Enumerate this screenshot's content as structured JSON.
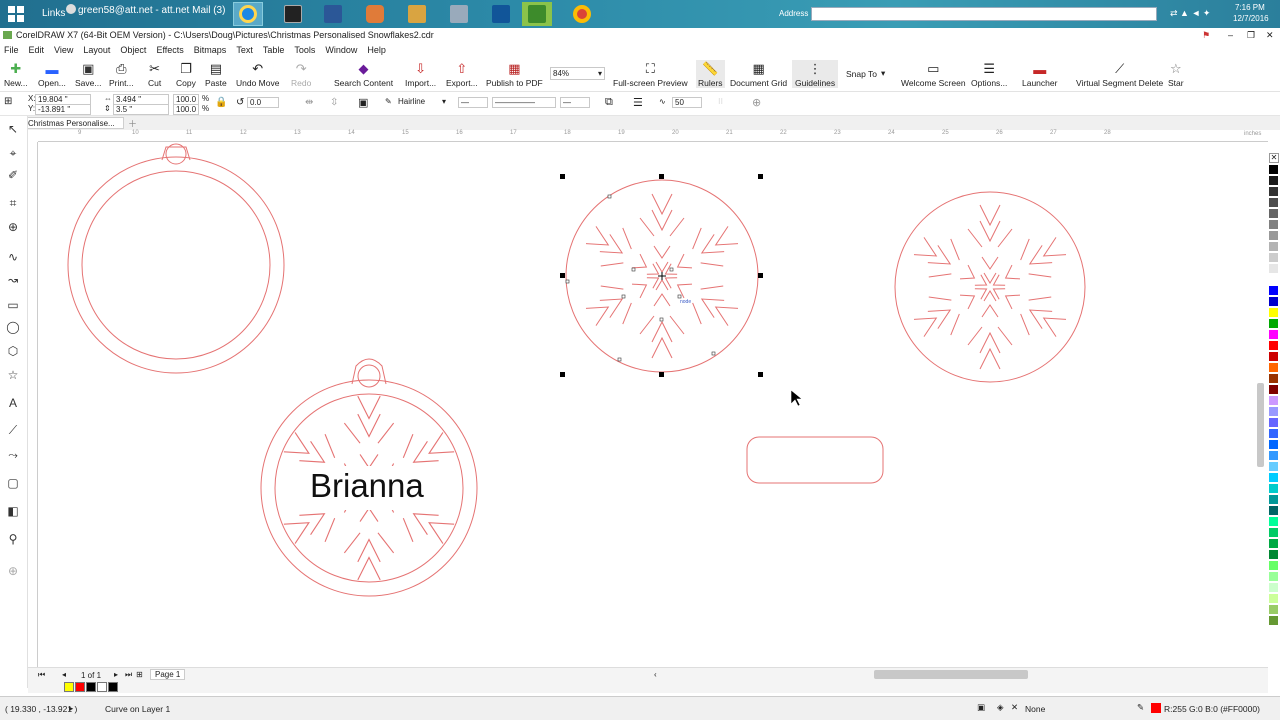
{
  "taskbar": {
    "links_label": "Links",
    "mail_tab": "green58@att.net - att.net Mail (3)",
    "address_label": "Address",
    "time": "7:16 PM",
    "date": "12/7/2016"
  },
  "window": {
    "title": "CorelDRAW X7 (64-Bit OEM Version) - C:\\Users\\Doug\\Pictures\\Christmas Personalised Snowflakes2.cdr"
  },
  "menu": [
    "File",
    "Edit",
    "View",
    "Layout",
    "Object",
    "Effects",
    "Bitmaps",
    "Text",
    "Table",
    "Tools",
    "Window",
    "Help"
  ],
  "toolbar": {
    "new": "New...",
    "open": "Open...",
    "save": "Save...",
    "print": "Print...",
    "cut": "Cut",
    "copy": "Copy",
    "paste": "Paste",
    "undo": "Undo Move",
    "redo": "Redo",
    "search": "Search Content",
    "import": "Import...",
    "export": "Export...",
    "publish": "Publish to PDF",
    "zoom": "84%",
    "fullscreen": "Full-screen Preview",
    "rulers": "Rulers",
    "grid": "Document Grid",
    "guidelines": "Guidelines",
    "snap": "Snap To",
    "welcome": "Welcome Screen",
    "options": "Options...",
    "launcher": "Launcher",
    "vsd": "Virtual Segment Delete",
    "star": "Star"
  },
  "propbar": {
    "x": "19.804 \"",
    "y": "-13.891 \"",
    "w": "3.494 \"",
    "h": "3.5 \"",
    "sx": "100.0",
    "sy": "100.0",
    "pct": "%",
    "rot": "0.0",
    "outline": "Hairline",
    "miter": "50"
  },
  "doctab": "Christmas Personalise...",
  "ruler_unit": "inches",
  "ruler_ticks": [
    "9",
    "10",
    "11",
    "12",
    "13",
    "14",
    "15",
    "16",
    "17",
    "18",
    "19",
    "20",
    "21",
    "22",
    "23",
    "24",
    "25",
    "26",
    "27",
    "28"
  ],
  "canvas": {
    "name_text": "Brianna",
    "node_label": "node"
  },
  "pagebar": {
    "pages": "1 of 1",
    "page_tab": "Page 1"
  },
  "status": {
    "coords": "( 19.330 , -13.921 )",
    "info": "Curve on Layer 1",
    "fill": "None",
    "outline": "R:255 G:0 B:0 (#FF0000)"
  },
  "colors": {
    "cut_line": "#e57373",
    "outline_swatch": "#ff0000"
  },
  "palette": [
    "#000000",
    "#1a1a1a",
    "#333333",
    "#4d4d4d",
    "#666666",
    "#808080",
    "#999999",
    "#b3b3b3",
    "#cccccc",
    "#e6e6e6",
    "#ffffff",
    "#0000ff",
    "#0000cc",
    "#ffff00",
    "#00aa00",
    "#ff00ff",
    "#ff0000",
    "#cc0000",
    "#ff6600",
    "#993300",
    "#800000",
    "#cc99ff",
    "#9999ff",
    "#6666ff",
    "#3366ff",
    "#0066ff",
    "#3399ff",
    "#66ccff",
    "#00ccff",
    "#00cccc",
    "#009999",
    "#006666",
    "#00ff99",
    "#00cc66",
    "#00aa44",
    "#008833",
    "#66ff66",
    "#99ff99",
    "#ccffcc",
    "#ccff99",
    "#99cc66",
    "#669933"
  ],
  "doc_palette": [
    "#ffff00",
    "#ff0000",
    "#000000",
    "#ffffff",
    "#000000"
  ]
}
